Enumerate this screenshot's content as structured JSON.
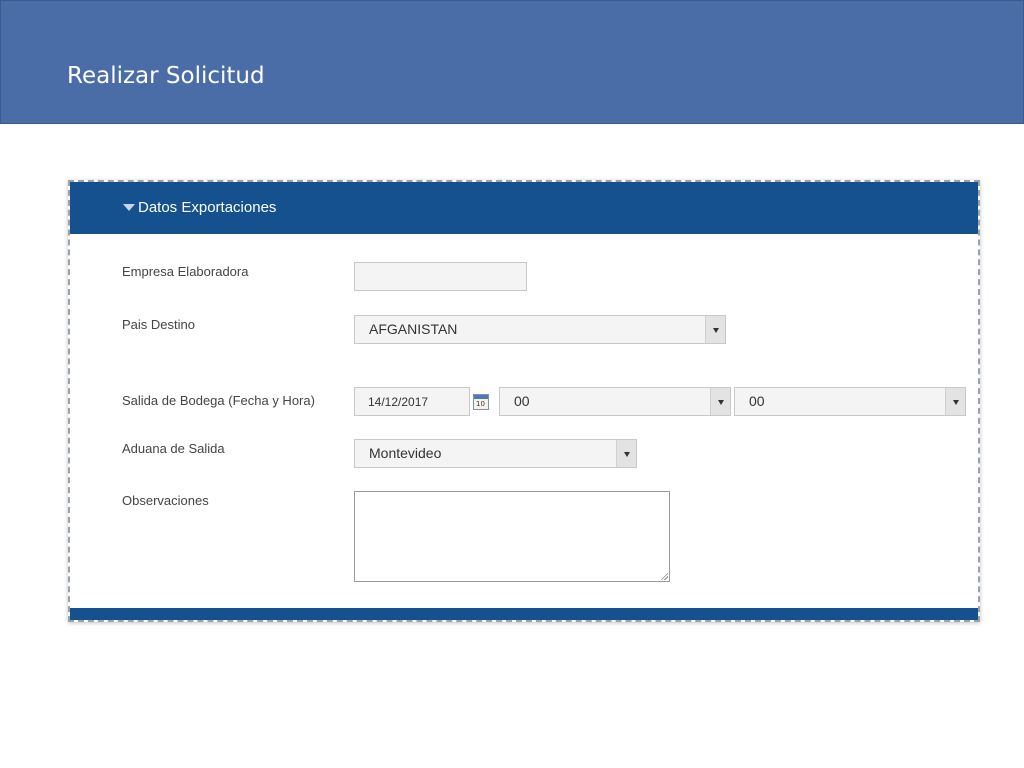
{
  "banner": {
    "title": "Realizar Solicitud"
  },
  "section": {
    "title": "Datos Exportaciones"
  },
  "form": {
    "empresa": {
      "label": "Empresa Elaboradora",
      "value": ""
    },
    "pais": {
      "label": "Pais Destino",
      "value": "AFGANISTAN"
    },
    "salida": {
      "label": "Salida de Bodega (Fecha y Hora)",
      "date": "14/12/2017",
      "hour": "00",
      "minute": "00"
    },
    "aduana": {
      "label": "Aduana de Salida",
      "value": "Montevideo"
    },
    "observaciones": {
      "label": "Observaciones",
      "value": ""
    }
  },
  "colors": {
    "banner": "#4a6da7",
    "panel_header": "#15508f"
  },
  "icons": {
    "section_toggle": "caret-down-icon",
    "date_picker": "calendar-icon",
    "calendar_day": "10"
  }
}
